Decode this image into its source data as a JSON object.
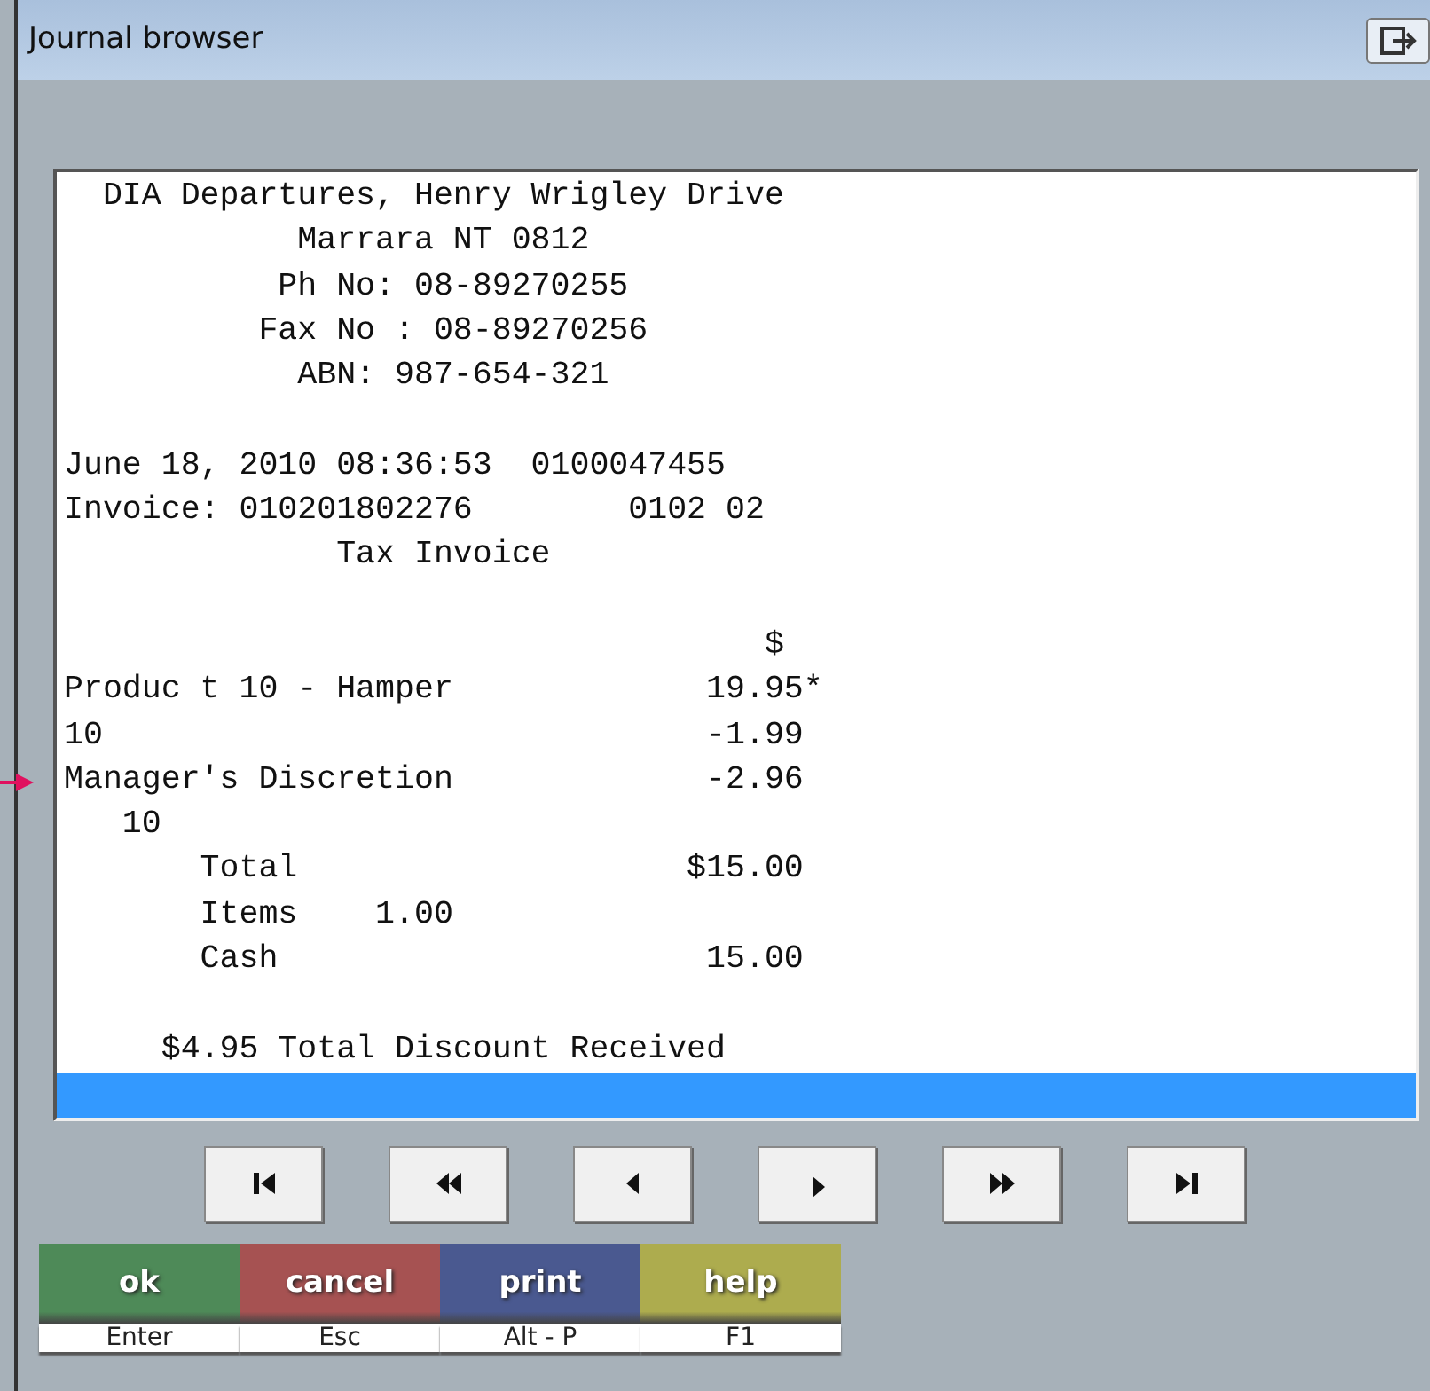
{
  "window": {
    "title": "Journal browser"
  },
  "receipt": {
    "blocks": [
      {
        "lines": [
          {
            "text": "  DIA Departures, Henry Wrigley Drive",
            "marked": false
          },
          {
            "text": "            Marrara NT 0812",
            "marked": false
          },
          {
            "text": "           Ph No: 08-89270255",
            "marked": false
          },
          {
            "text": "          Fax No : 08-89270256",
            "marked": false
          },
          {
            "text": "            ABN: 987-654-321",
            "marked": false
          }
        ]
      },
      {
        "lines": [
          {
            "text": "June 18, 2010 08:36:53  0100047455",
            "marked": false
          },
          {
            "text": "Invoice: 010201802276        0102 02",
            "marked": false
          },
          {
            "text": "              Tax Invoice",
            "marked": false
          }
        ]
      },
      {
        "lines": [
          {
            "text": "                                    $",
            "marked": false
          },
          {
            "text": "Produc t 10 - Hamper             19.95*",
            "marked": false
          },
          {
            "text": "10                               -1.99",
            "marked": false
          },
          {
            "text": "Manager's Discretion             -2.96",
            "marked": true
          },
          {
            "text": "   10",
            "marked": false
          },
          {
            "text": "       Total                    $15.00",
            "marked": false
          },
          {
            "text": "       Items    1.00",
            "marked": false
          },
          {
            "text": "       Cash                      15.00",
            "marked": false
          }
        ]
      },
      {
        "lines": [
          {
            "text": "     $4.95 Total Discount Received",
            "marked": false
          }
        ]
      }
    ],
    "selection_bar": true
  },
  "navigation": [
    {
      "kind": "first"
    },
    {
      "kind": "rewind"
    },
    {
      "kind": "previous"
    },
    {
      "kind": "next"
    },
    {
      "kind": "fast-forward"
    },
    {
      "kind": "last"
    }
  ],
  "actions": [
    {
      "label": "ok",
      "shortcut": "Enter",
      "color": "#4e8a58"
    },
    {
      "label": "cancel",
      "shortcut": "Esc",
      "color": "#a65252"
    },
    {
      "label": "print",
      "shortcut": "Alt - P",
      "color": "#4a5990"
    },
    {
      "label": "help",
      "shortcut": "F1",
      "color": "#adac4e"
    }
  ]
}
